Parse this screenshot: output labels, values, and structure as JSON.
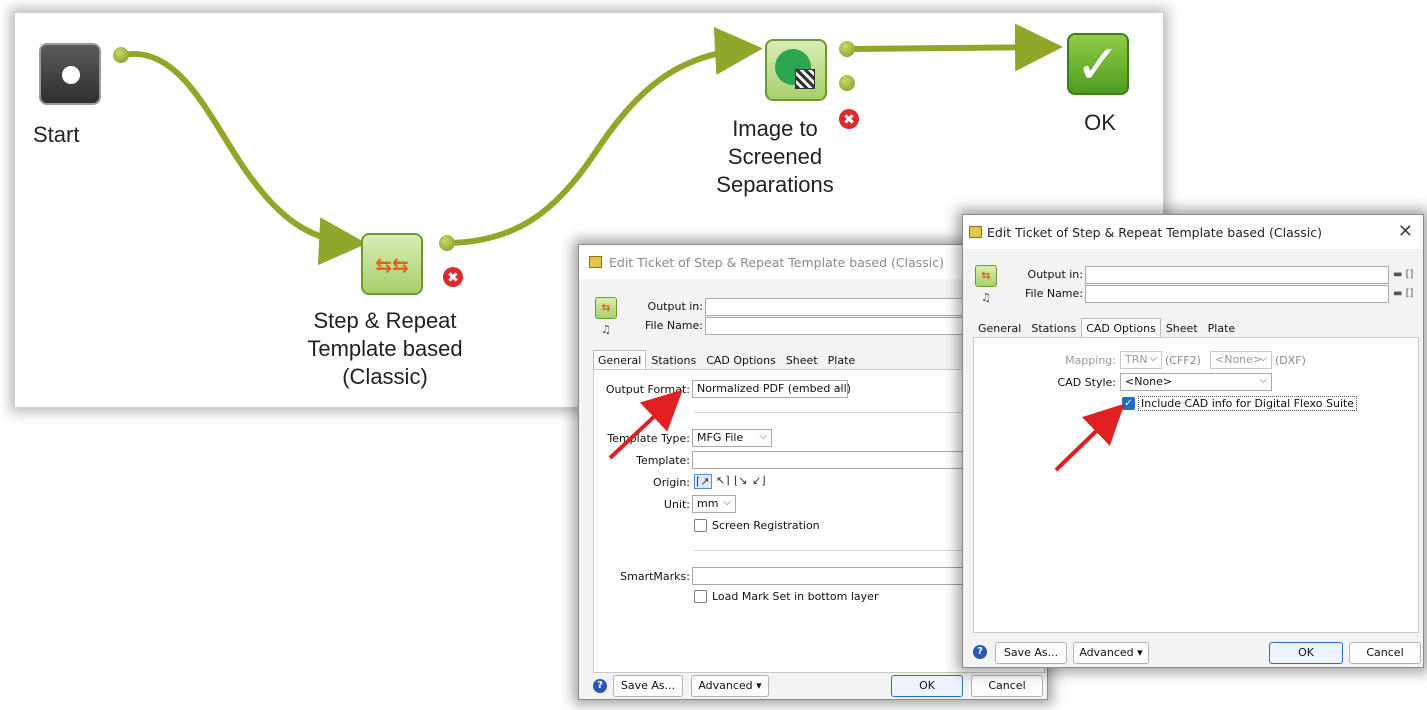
{
  "workflow": {
    "start_label": "Start",
    "step_label_lines": [
      "Step & Repeat",
      "Template based",
      "(Classic)"
    ],
    "image_label_lines": [
      "Image to",
      "Screened",
      "Separations"
    ],
    "ok_label": "OK",
    "ok_symbol": "✓",
    "step_icon": "⇆⇆",
    "asterisk": "*",
    "error_symbol": "✖",
    "connector_color": "#8fa82a",
    "icons": [
      "start-icon",
      "step-repeat-icon",
      "image-screening-icon",
      "ok-check-icon",
      "error-icon"
    ]
  },
  "dialog1": {
    "title": "Edit Ticket of Step & Repeat Template based (Classic)",
    "output_in_label": "Output in:",
    "file_name_label": "File Name:",
    "tabs": [
      "General",
      "Stations",
      "CAD Options",
      "Sheet",
      "Plate"
    ],
    "active_tab": "General",
    "output_format_label": "Output Format:",
    "output_format_value": "Normalized PDF (embed all)",
    "template_type_label": "Template Type:",
    "template_type_value": "MFG File",
    "template_label": "Template:",
    "origin_label": "Origin:",
    "unit_label": "Unit:",
    "unit_value": "mm",
    "screen_registration_label": "Screen Registration",
    "smartmarks_label": "SmartMarks:",
    "load_mark_set_label": "Load Mark Set in bottom layer",
    "save_as_label": "Save As...",
    "advanced_label": "Advanced ▾",
    "ok_label": "OK",
    "cancel_label": "Cancel",
    "help_symbol": "?"
  },
  "dialog2": {
    "title": "Edit Ticket of Step & Repeat Template based (Classic)",
    "close_symbol": "✕",
    "output_in_label": "Output in:",
    "file_name_label": "File Name:",
    "tabs": [
      "General",
      "Stations",
      "CAD Options",
      "Sheet",
      "Plate"
    ],
    "active_tab": "CAD Options",
    "mapping_label": "Mapping:",
    "mapping_value1": "TRN",
    "mapping_suffix1": "(CFF2)",
    "mapping_value2": "<None>",
    "mapping_suffix2": "(DXF)",
    "cad_style_label": "CAD Style:",
    "cad_style_value": "<None>",
    "include_cad_label": "Include CAD info for Digital Flexo Suite",
    "include_cad_checked": true,
    "save_as_label": "Save As...",
    "advanced_label": "Advanced ▾",
    "ok_label": "OK",
    "cancel_label": "Cancel",
    "help_symbol": "?"
  },
  "colors": {
    "arrow_red": "#e02020",
    "checkbox_blue": "#1e6ccf",
    "ok_green": "#4f9c20"
  }
}
